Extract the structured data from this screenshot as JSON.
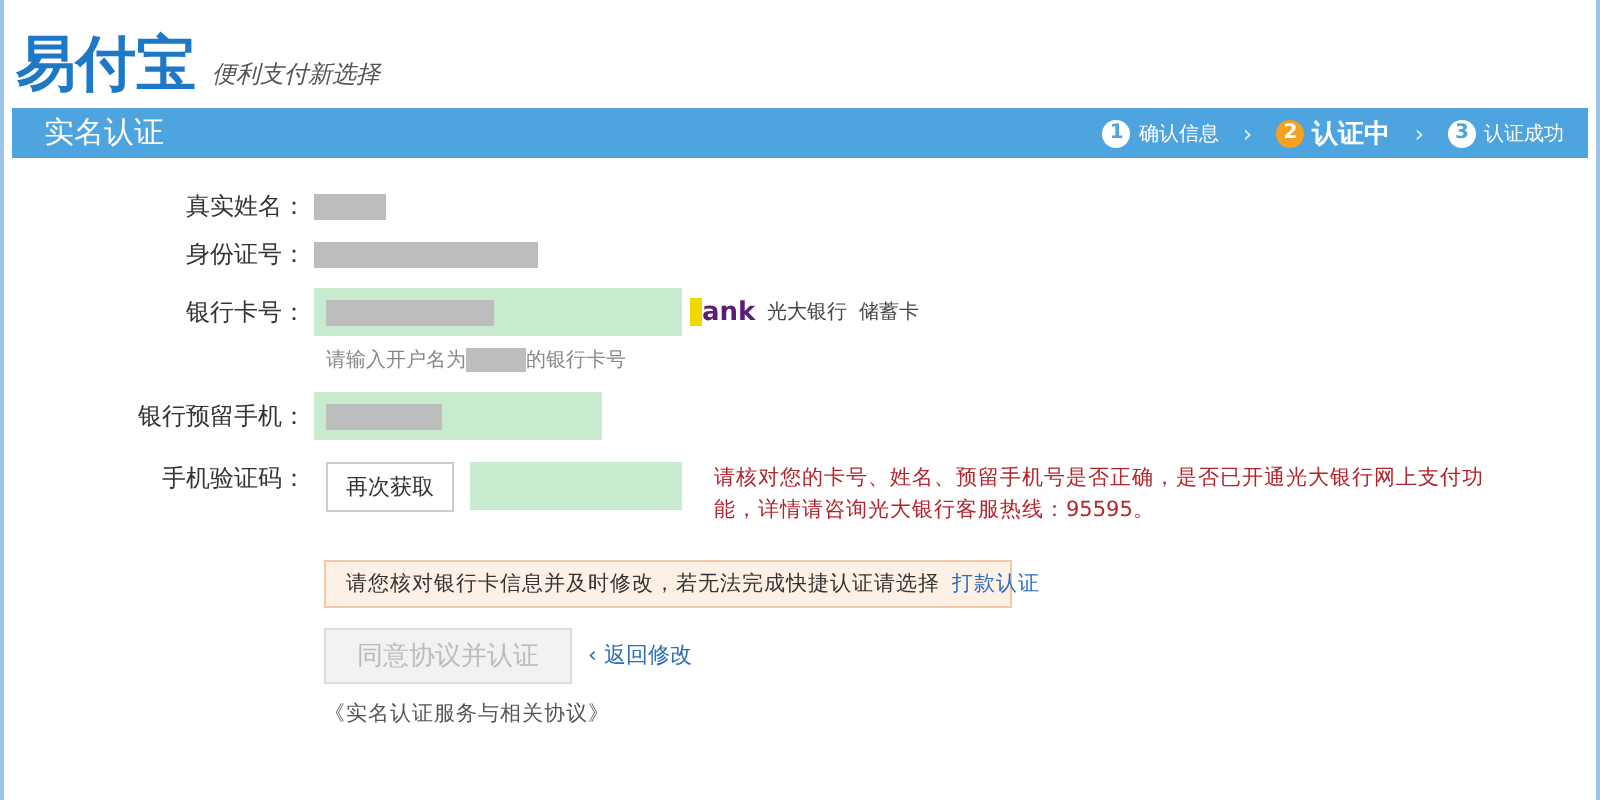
{
  "logo": {
    "name": "易付宝",
    "slogan": "便利支付新选择"
  },
  "header": {
    "title": "实名认证"
  },
  "steps": [
    {
      "number": "1",
      "label": "确认信息",
      "selected": false
    },
    {
      "number": "2",
      "label": "认证中",
      "selected": true
    },
    {
      "number": "3",
      "label": "认证成功",
      "selected": false
    }
  ],
  "step_separator": "›",
  "form": {
    "real_name": {
      "label": "真实姓名："
    },
    "id_number": {
      "label": "身份证号："
    },
    "bank_card": {
      "label": "银行卡号：",
      "bank_logo": "ank",
      "bank_name": "光大银行",
      "card_type": "储蓄卡",
      "hint_before": "请输入开户名为",
      "hint_after": "的银行卡号"
    },
    "phone": {
      "label": "银行预留手机："
    },
    "sms_code": {
      "label": "手机验证码：",
      "button": "再次获取",
      "error": "请核对您的卡号、姓名、预留手机号是否正确，是否已开通光大银行网上支付功能，详情请咨询光大银行客服热线：95595。"
    }
  },
  "notice": {
    "text": "请您核对银行卡信息并及时修改，若无法完成快捷认证请选择",
    "link": "打款认证"
  },
  "submit": {
    "label": "同意协议并认证",
    "disabled": true
  },
  "back_link": {
    "arrow": "‹",
    "label": "返回修改"
  },
  "agreement_link": "《实名认证服务与相关协议》"
}
